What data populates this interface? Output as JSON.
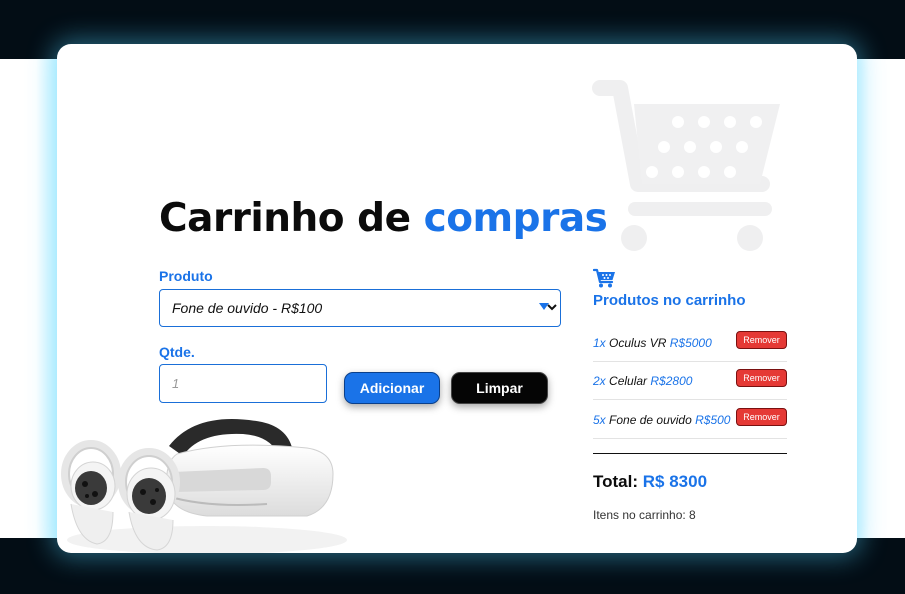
{
  "page": {
    "title_prefix": "Carrinho de",
    "title_accent": "compras",
    "accent_color": "#1a73e8"
  },
  "form": {
    "product_label": "Produto",
    "product_selected": "Fone de ouvido - R$100",
    "qty_label": "Qtde.",
    "qty_placeholder": "1",
    "add_label": "Adicionar",
    "clear_label": "Limpar"
  },
  "cart": {
    "heading": "Produtos no carrinho",
    "icon": "shopping-cart-icon",
    "items": [
      {
        "qty": "1x",
        "name": "Oculus VR",
        "price": "R$5000",
        "remove_label": "Remover"
      },
      {
        "qty": "2x",
        "name": "Celular",
        "price": "R$2800",
        "remove_label": "Remover"
      },
      {
        "qty": "5x",
        "name": "Fone de ouvido",
        "price": "R$500",
        "remove_label": "Remover"
      }
    ],
    "total_label": "Total:",
    "total_value": "R$ 8300",
    "items_count_text": "Itens no carrinho: 8"
  },
  "colors": {
    "remove_button": "#e53935",
    "clear_button": "#050505",
    "glow": "#50d2ff"
  }
}
